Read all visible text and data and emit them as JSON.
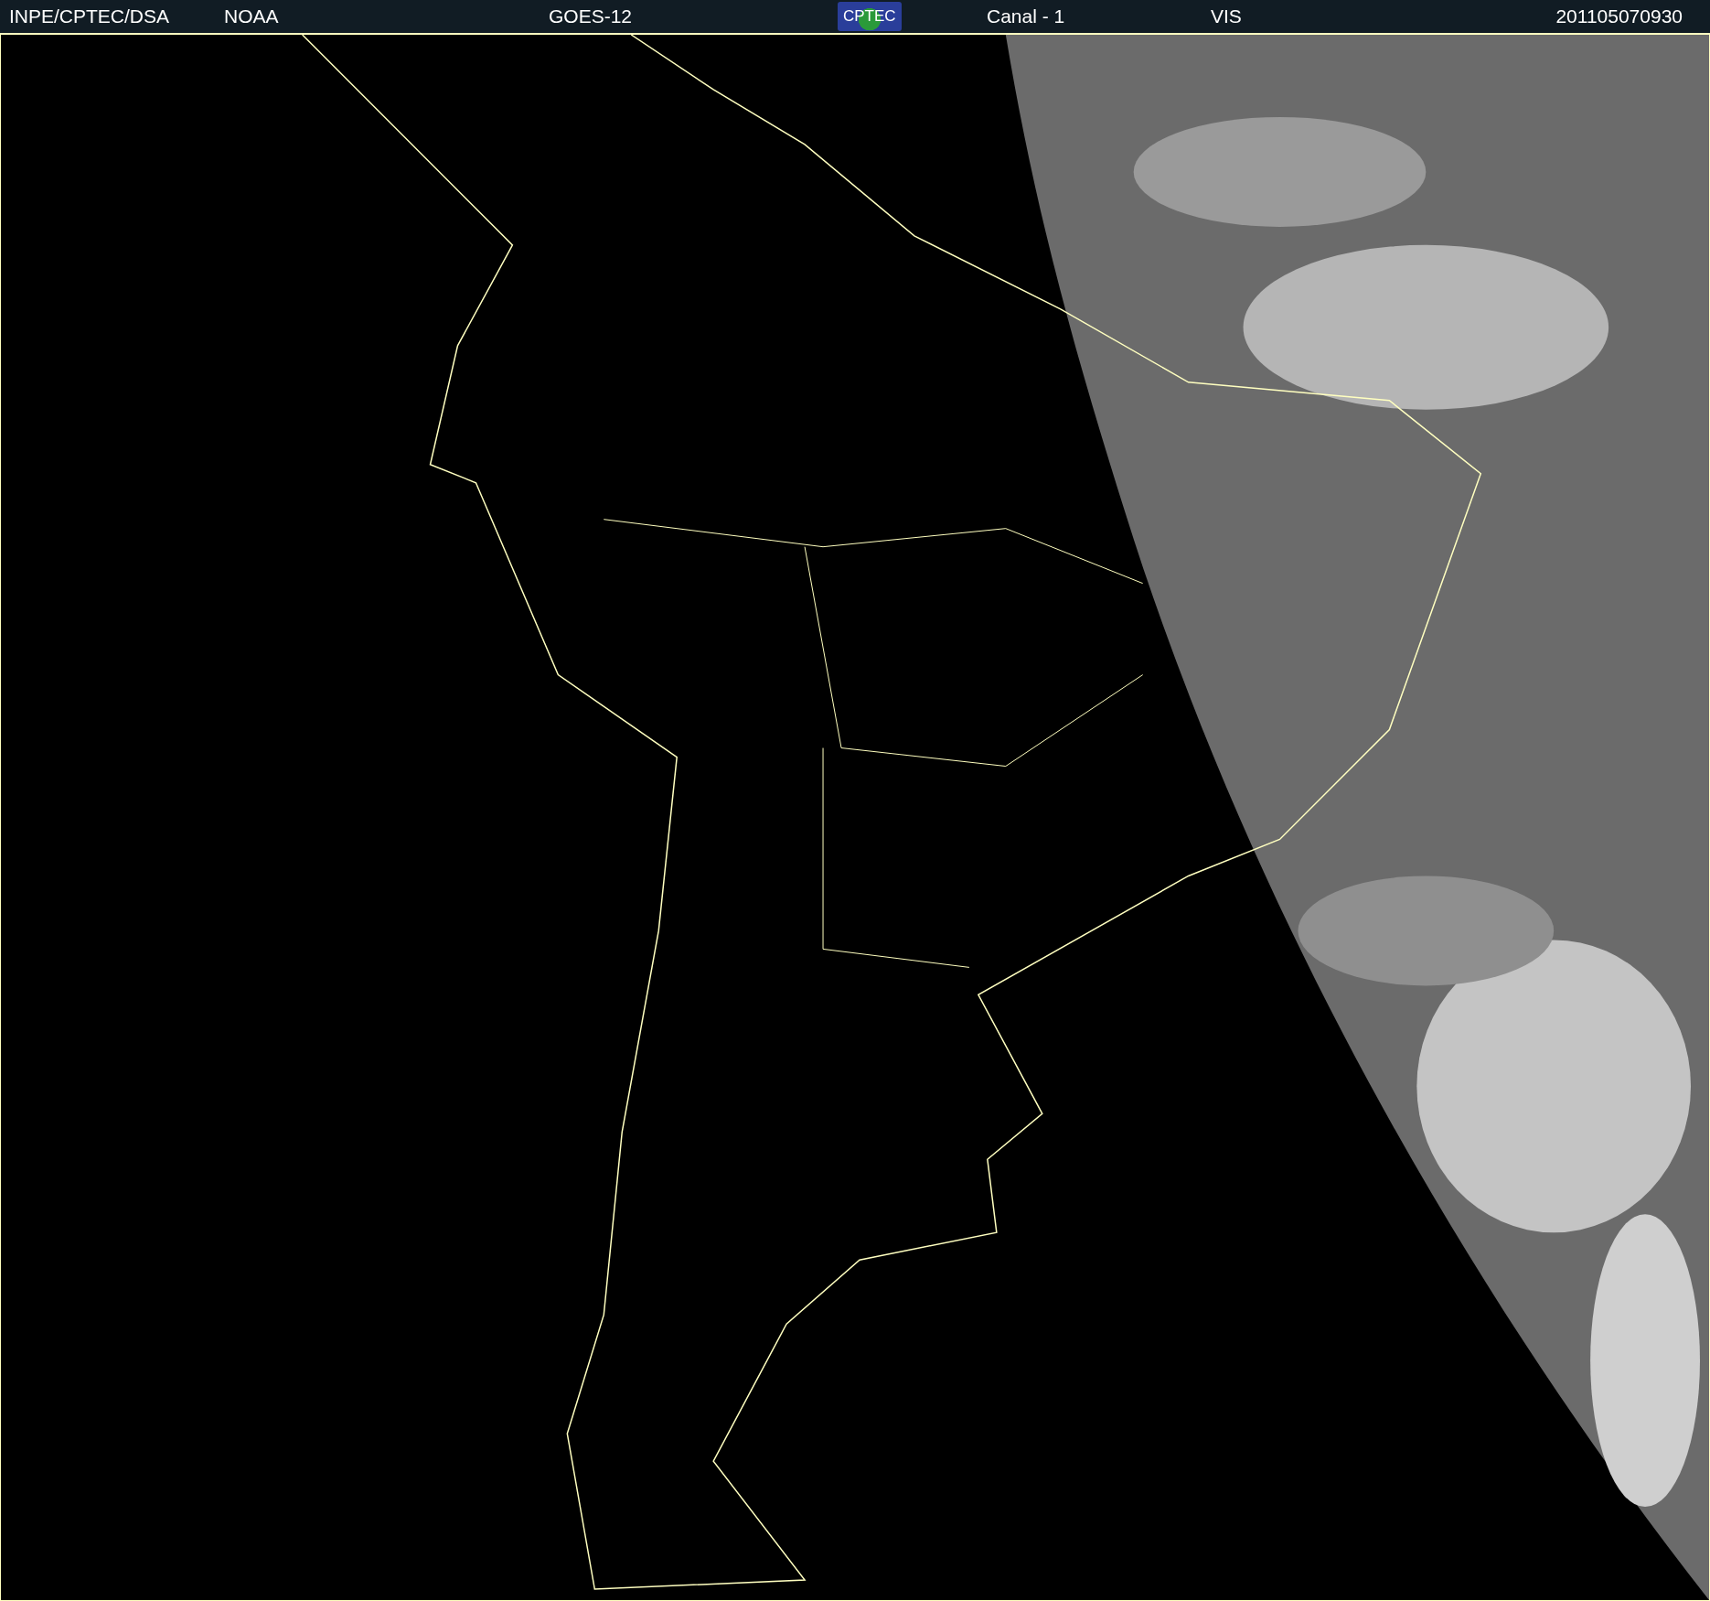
{
  "header": {
    "items": [
      {
        "kind": "text",
        "text": "INPE/CPTEC/DSA"
      },
      {
        "kind": "text",
        "text": "NOAA"
      },
      {
        "kind": "text",
        "text": "GOES-12"
      },
      {
        "kind": "logo",
        "text": "CPTEC"
      },
      {
        "kind": "text",
        "text": "Canal - 1"
      },
      {
        "kind": "text",
        "text": "VIS"
      },
      {
        "kind": "text",
        "text": "201105070930"
      }
    ]
  }
}
